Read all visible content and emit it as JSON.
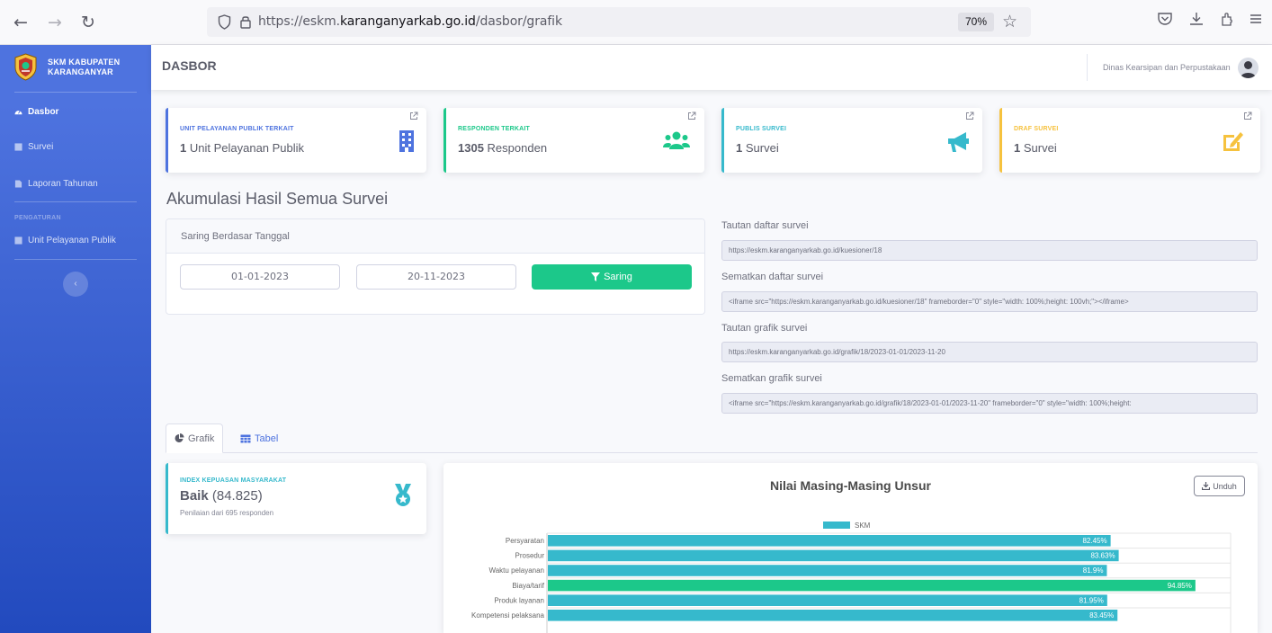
{
  "browser": {
    "url_prefix": "https://eskm.",
    "url_domain": "karanganyarkab.go.id",
    "url_path": "/dasbor/grafik",
    "zoom": "70%"
  },
  "sidebar": {
    "brand_line1": "SKM KABUPATEN",
    "brand_line2": "KARANGANYAR",
    "items": [
      {
        "label": "Dasbor",
        "icon": "dashboard-icon",
        "active": true
      },
      {
        "label": "Survei",
        "icon": "survey-icon"
      },
      {
        "label": "Laporan Tahunan",
        "icon": "report-icon"
      }
    ],
    "heading": "PENGATURAN",
    "settings_items": [
      {
        "label": "Unit Pelayanan Publik",
        "icon": "unit-icon"
      }
    ],
    "toggle_label": "‹"
  },
  "topbar": {
    "title": "DASBOR",
    "user": "Dinas Kearsipan dan Perpustakaan"
  },
  "stats": [
    {
      "label": "UNIT PELAYANAN PUBLIK TERKAIT",
      "number": "1",
      "unit": "Unit Pelayanan Publik",
      "color": "#4e73df",
      "icon": "building-icon"
    },
    {
      "label": "RESPONDEN TERKAIT",
      "number": "1305",
      "unit": "Responden",
      "color": "#1cc88a",
      "icon": "users-icon"
    },
    {
      "label": "PUBLIS SURVEI",
      "number": "1",
      "unit": "Survei",
      "color": "#36b9cc",
      "icon": "megaphone-icon"
    },
    {
      "label": "DRAF SURVEI",
      "number": "1",
      "unit": "Survei",
      "color": "#f6c23e",
      "icon": "edit-icon"
    }
  ],
  "section_title": "Akumulasi Hasil Semua Survei",
  "filter": {
    "header": "Saring Berdasar Tanggal",
    "date_from": "01-01-2023",
    "date_to": "20-11-2023",
    "button": "Saring"
  },
  "links": [
    {
      "label": "Tautan daftar survei",
      "value": "https://eskm.karanganyarkab.go.id/kuesioner/18"
    },
    {
      "label": "Sematkan daftar survei",
      "value": "<iframe src=\"https://eskm.karanganyarkab.go.id/kuesioner/18\" frameborder=\"0\" style=\"width: 100%;height: 100vh;\"></iframe>"
    },
    {
      "label": "Tautan grafik survei",
      "value": "https://eskm.karanganyarkab.go.id/grafik/18/2023-01-01/2023-11-20"
    },
    {
      "label": "Sematkan grafik survei",
      "value": "<iframe src=\"https://eskm.karanganyarkab.go.id/grafik/18/2023-01-01/2023-11-20\" frameborder=\"0\" style=\"width: 100%;height:"
    }
  ],
  "tabs": {
    "grafik": "Grafik",
    "tabel": "Tabel"
  },
  "ikm": {
    "label": "INDEX KEPUASAN MASYARAKAT",
    "grade": "Baik",
    "score": "(84.825)",
    "sub": "Penilaian dari 695 responden"
  },
  "chart": {
    "download": "Unduh"
  },
  "chart_data": {
    "type": "bar",
    "orientation": "horizontal",
    "title": "Nilai Masing-Masing Unsur",
    "categories": [
      "Persyaratan",
      "Prosedur",
      "Waktu pelayanan",
      "Biaya/tarif",
      "Produk layanan",
      "Kompetensi pelaksana"
    ],
    "series": [
      {
        "name": "SKM",
        "values": [
          82.45,
          83.63,
          81.9,
          94.85,
          81.95,
          83.45
        ],
        "labels": [
          "82.45%",
          "83.63%",
          "81.9%",
          "94.85%",
          "81.95%",
          "83.45%"
        ]
      }
    ],
    "xlim": [
      0,
      100
    ],
    "legend": "top",
    "colors": {
      "default": "#36b9cc",
      "highlight": "#1cc88a"
    },
    "highlight_category": "Biaya/tarif"
  }
}
